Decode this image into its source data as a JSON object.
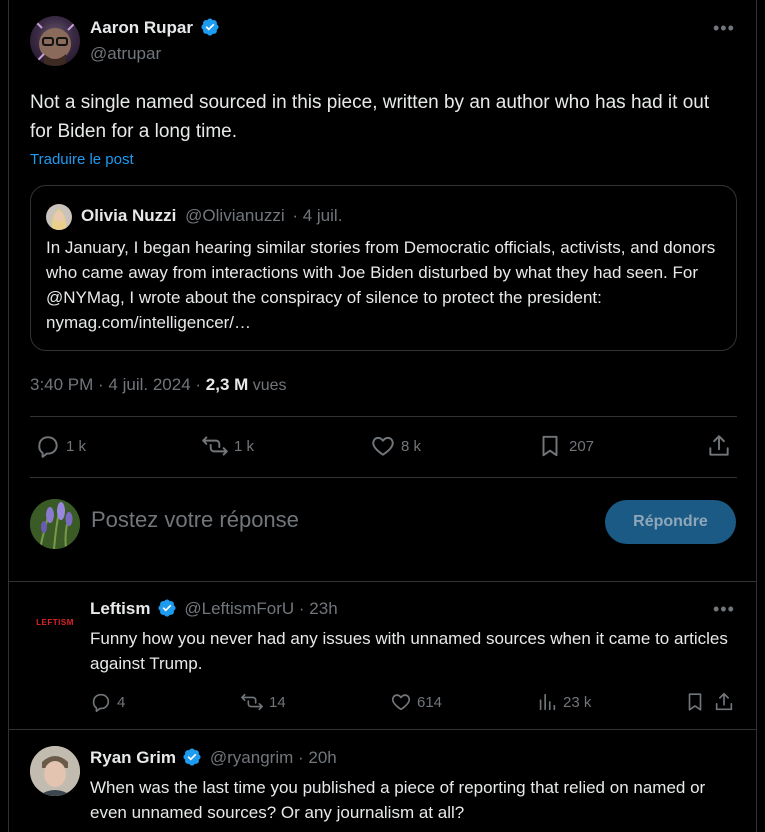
{
  "main_tweet": {
    "author_name": "Aaron Rupar",
    "author_handle": "@atrupar",
    "text": "Not a single named sourced in this piece, written by an author who has had it out for Biden for a long time.",
    "translate_link": "Traduire le post",
    "quoted": {
      "author_name": "Olivia Nuzzi",
      "author_handle": "@Olivianuzzi",
      "date": "· 4 juil.",
      "text": "In January, I began hearing similar stories from Democratic officials, activists, and donors who came away from interactions with Joe Biden disturbed by what they had seen. For @NYMag, I wrote about the conspiracy of silence to protect the president: nymag.com/intelligencer/…"
    },
    "meta_time": "3:40 PM · 4 juil. 2024 · ",
    "meta_views_count": "2,3 M",
    "meta_views_label": " vues",
    "actions": {
      "replies": "1 k",
      "reposts": "1 k",
      "likes": "8 k",
      "bookmarks": "207"
    }
  },
  "reply_box": {
    "placeholder": "Postez votre réponse",
    "button": "Répondre"
  },
  "replies": [
    {
      "author_name": "Leftism",
      "author_handle": "@LeftismForU · 23h",
      "avatar_text": "LEFTISM",
      "text": "Funny how you never had any issues with unnamed sources when it came to articles against Trump.",
      "replies": "4",
      "reposts": "14",
      "likes": "614",
      "views": "23 k"
    },
    {
      "author_name": "Ryan Grim",
      "author_handle": "@ryangrim · 20h",
      "text": "When was the last time you published a piece of reporting that relied on named or even unnamed sources? Or any journalism at all?"
    }
  ],
  "colors": {
    "background": "#000000",
    "text": "#e7e9ea",
    "muted": "#71767b",
    "accent": "#1d9bf0",
    "button_bg": "#1a5a85",
    "border": "#2f3336"
  }
}
